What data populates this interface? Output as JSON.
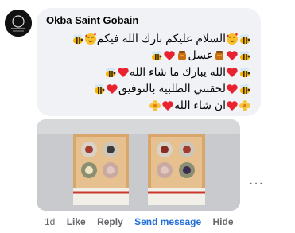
{
  "comment": {
    "author": "Okba Saint Gobain",
    "lines": [
      "السلام عليكم بارك الله فيكم",
      "عسل",
      "الله يبارك ما شاء الله",
      "لحقتني الطلبية بالتوفيق",
      "ان شاء الله"
    ],
    "icons": [
      "bee-emoji",
      "smiling-face-with-hearts-emoji",
      "red-heart-emoji",
      "honey-pot-emoji",
      "hibiscus-emoji"
    ]
  },
  "actions": {
    "time": "1d",
    "like": "Like",
    "reply": "Reply",
    "send_message": "Send message",
    "hide": "Hide"
  },
  "more_glyph": "···",
  "colors": {
    "bubble_bg": "#f0f2f5",
    "link_blue": "#216fdb",
    "muted_text": "#65676b"
  }
}
